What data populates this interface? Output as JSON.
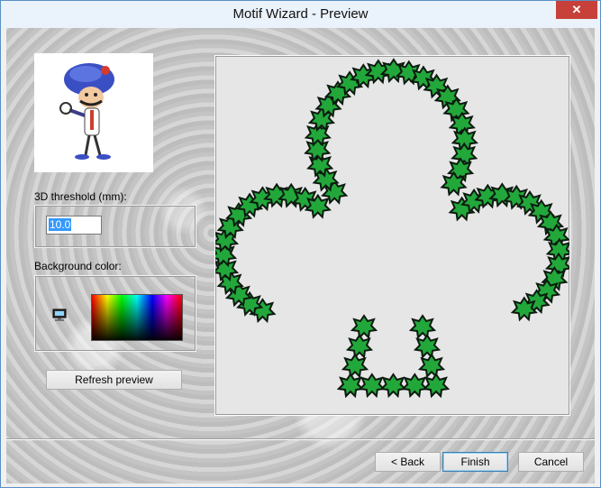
{
  "window": {
    "title": "Motif Wizard - Preview",
    "close_glyph": "✕"
  },
  "thumbnail": {
    "icon": "cartoon-character-image"
  },
  "threshold": {
    "label": "3D threshold (mm):",
    "value": "10.0"
  },
  "background": {
    "label": "Background color:",
    "icon": "monitor-icon"
  },
  "buttons": {
    "refresh": "Refresh preview",
    "back": "< Back",
    "finish": "Finish",
    "cancel": "Cancel"
  },
  "preview": {
    "shape": "club",
    "motif_color": "#22a83a",
    "motif_outline": "#0d1a10"
  },
  "colors": {
    "accent": "#3399ff",
    "close": "#c7403a"
  }
}
